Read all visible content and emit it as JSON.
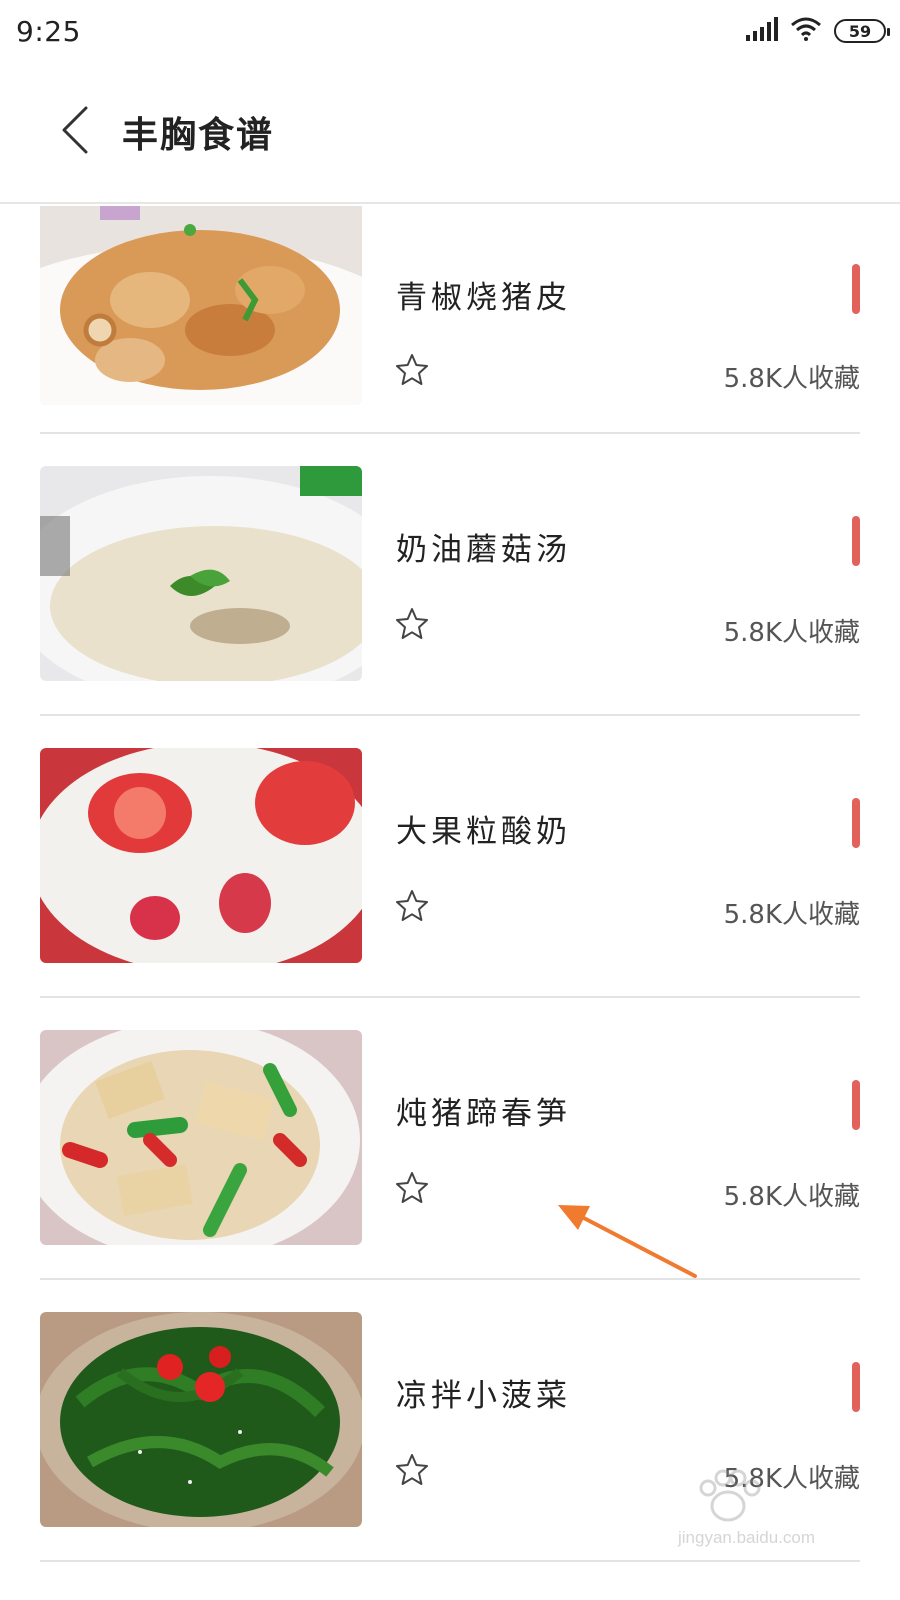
{
  "status_bar": {
    "time": "9:25",
    "battery": "59",
    "icons": [
      "signal-icon",
      "wifi-icon",
      "battery-icon"
    ]
  },
  "app_bar": {
    "back_icon": "chevron-left-icon",
    "title": "丰胸食谱"
  },
  "recipes": [
    {
      "name": "青椒烧猪皮",
      "favorites": "5.8K人收藏",
      "image": "stewed-pork-skin-photo"
    },
    {
      "name": "奶油蘑菇汤",
      "favorites": "5.8K人收藏",
      "image": "cream-mushroom-soup-photo"
    },
    {
      "name": "大果粒酸奶",
      "favorites": "5.8K人收藏",
      "image": "strawberry-yogurt-photo"
    },
    {
      "name": "炖猪蹄春笋",
      "favorites": "5.8K人收藏",
      "image": "pork-trotter-bamboo-shoot-photo"
    },
    {
      "name": "凉拌小菠菜",
      "favorites": "5.8K人收藏",
      "image": "spinach-salad-photo"
    }
  ],
  "colors": {
    "accent_bar": "#e2625b",
    "annotation_arrow": "#f07a2e",
    "divider": "#e3e3e3"
  },
  "watermark": {
    "text": "jingyan.baidu.com"
  }
}
